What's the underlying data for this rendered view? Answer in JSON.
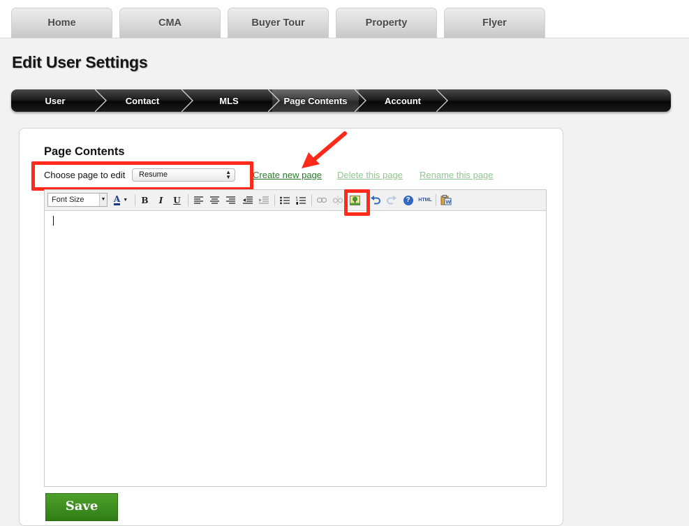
{
  "nav": {
    "tabs": [
      {
        "label": "Home"
      },
      {
        "label": "CMA"
      },
      {
        "label": "Buyer Tour"
      },
      {
        "label": "Property"
      },
      {
        "label": "Flyer"
      }
    ]
  },
  "page": {
    "title": "Edit User Settings"
  },
  "steps": [
    {
      "label": "User",
      "active": false
    },
    {
      "label": "Contact",
      "active": false
    },
    {
      "label": "MLS",
      "active": false
    },
    {
      "label": "Page Contents",
      "active": true
    },
    {
      "label": "Account",
      "active": false
    }
  ],
  "section": {
    "title": "Page Contents",
    "choose_label": "Choose page to edit",
    "selected_page": "Resume",
    "links": {
      "create": "Create new page",
      "delete": "Delete this page",
      "rename": "Rename this page"
    }
  },
  "editor": {
    "font_size_placeholder": "Font Size",
    "toolbar_icons": [
      "font-color-icon",
      "bold-icon",
      "italic-icon",
      "underline-icon",
      "align-left-icon",
      "align-center-icon",
      "align-right-icon",
      "outdent-icon",
      "indent-icon",
      "bullet-list-icon",
      "numbered-list-icon",
      "link-icon",
      "unlink-icon",
      "insert-image-icon",
      "undo-icon",
      "redo-icon",
      "help-icon",
      "html-source-icon",
      "paste-word-icon"
    ],
    "bold_glyph": "B",
    "italic_glyph": "I",
    "underline_glyph": "U",
    "font_color_glyph": "A",
    "html_glyph": "HTML",
    "help_glyph": "?"
  },
  "actions": {
    "save_label": "Save"
  },
  "colors": {
    "highlight": "#ff2a1a",
    "link_primary": "#2a7a2a",
    "link_muted": "#8fc68f",
    "save_green": "#3f8e20"
  }
}
